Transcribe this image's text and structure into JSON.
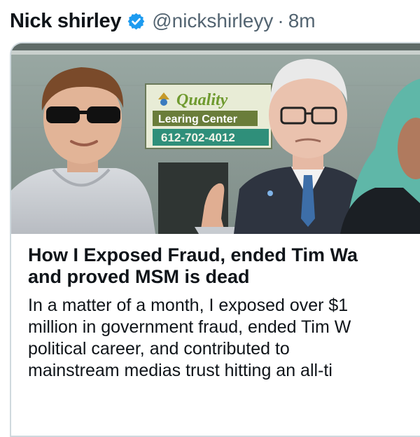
{
  "post": {
    "author_name": "Nick shirley",
    "handle": "@nickshirleyy",
    "separator": "·",
    "time_ago": "8m",
    "verified": true
  },
  "link_card": {
    "image": {
      "sign": {
        "brand": "Quality",
        "subtitle": "Learing Center",
        "phone": "612-702-4012"
      }
    },
    "title_lines": [
      "How I Exposed Fraud, ended Tim Wa",
      "and proved MSM is dead"
    ],
    "description_lines": [
      "In a matter of a month, I exposed over $1",
      "million in government fraud, ended Tim W",
      "political career, and contributed to",
      "mainstream medias trust hitting an all-ti"
    ]
  },
  "colors": {
    "verified_blue": "#1d9bf0",
    "secondary_text": "#536471",
    "border": "#cfd9de"
  }
}
